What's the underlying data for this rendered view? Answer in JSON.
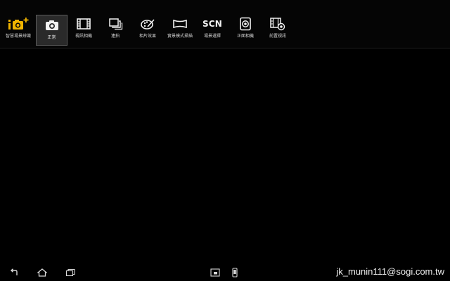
{
  "modes": [
    {
      "id": "superior-auto",
      "label": "智慧場景辨識",
      "icon": "superior-auto-camera-icon",
      "selected": false
    },
    {
      "id": "normal",
      "label": "正常",
      "icon": "camera-icon",
      "selected": true
    },
    {
      "id": "video",
      "label": "視訊相機",
      "icon": "film-icon",
      "selected": false
    },
    {
      "id": "burst",
      "label": "連拍",
      "icon": "burst-icon",
      "selected": false
    },
    {
      "id": "picture-effect",
      "label": "相片效果",
      "icon": "palette-icon",
      "selected": false
    },
    {
      "id": "sweep-panorama",
      "label": "實景模式掃描",
      "icon": "panorama-icon",
      "selected": false
    },
    {
      "id": "scene",
      "label": "場景選擇",
      "icon_text": "SCN",
      "icon": "scn-icon",
      "selected": false
    },
    {
      "id": "front-camera",
      "label": "正面相機",
      "icon": "front-camera-icon",
      "selected": false
    },
    {
      "id": "front-video",
      "label": "前置視訊",
      "icon": "front-video-icon",
      "selected": false
    }
  ],
  "nav": {
    "back": "back-icon",
    "home": "home-icon",
    "recent": "recent-apps-icon",
    "small_app": "small-app-icon",
    "screenshot": "phone-icon"
  },
  "watermark": "jk_munin111@sogi.com.tw",
  "colors": {
    "background": "#000000",
    "accent": "#f0b400",
    "selected_bg": "#2a2a2a"
  }
}
